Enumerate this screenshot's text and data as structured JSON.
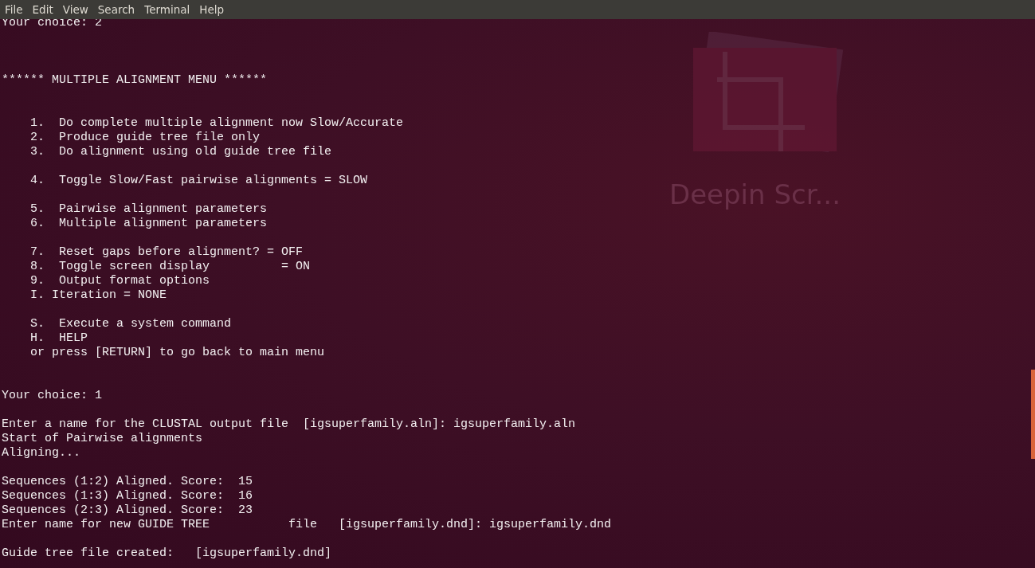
{
  "menu_bar": [
    "File",
    "Edit",
    "View",
    "Search",
    "Terminal",
    "Help"
  ],
  "background_app": {
    "label": "Deepin Scr..."
  },
  "terminal_lines": [
    {
      "kind": "text",
      "text": "Your choice: 2"
    },
    {
      "kind": "blank"
    },
    {
      "kind": "blank"
    },
    {
      "kind": "blank"
    },
    {
      "kind": "text",
      "text": "****** MULTIPLE ALIGNMENT MENU ******"
    },
    {
      "kind": "blank"
    },
    {
      "kind": "blank"
    },
    {
      "kind": "text",
      "text": "    1.  Do complete multiple alignment now Slow/Accurate"
    },
    {
      "kind": "text",
      "text": "    2.  Produce guide tree file only"
    },
    {
      "kind": "text",
      "text": "    3.  Do alignment using old guide tree file"
    },
    {
      "kind": "blank"
    },
    {
      "kind": "text",
      "text": "    4.  Toggle Slow/Fast pairwise alignments = SLOW"
    },
    {
      "kind": "blank"
    },
    {
      "kind": "text",
      "text": "    5.  Pairwise alignment parameters"
    },
    {
      "kind": "text",
      "text": "    6.  Multiple alignment parameters"
    },
    {
      "kind": "blank"
    },
    {
      "kind": "text",
      "text": "    7.  Reset gaps before alignment? = OFF"
    },
    {
      "kind": "text",
      "text": "    8.  Toggle screen display          = ON"
    },
    {
      "kind": "text",
      "text": "    9.  Output format options"
    },
    {
      "kind": "text",
      "text": "    I. Iteration = NONE"
    },
    {
      "kind": "blank"
    },
    {
      "kind": "text",
      "text": "    S.  Execute a system command"
    },
    {
      "kind": "text",
      "text": "    H.  HELP"
    },
    {
      "kind": "text",
      "text": "    or press [RETURN] to go back to main menu"
    },
    {
      "kind": "blank"
    },
    {
      "kind": "blank"
    },
    {
      "kind": "text",
      "text": "Your choice: 1"
    },
    {
      "kind": "blank"
    },
    {
      "kind": "text",
      "text": "Enter a name for the CLUSTAL output file  [igsuperfamily.aln]: igsuperfamily.aln"
    },
    {
      "kind": "text",
      "text": "Start of Pairwise alignments"
    },
    {
      "kind": "text",
      "text": "Aligning..."
    },
    {
      "kind": "blank"
    },
    {
      "kind": "text",
      "text": "Sequences (1:2) Aligned. Score:  15"
    },
    {
      "kind": "text",
      "text": "Sequences (1:3) Aligned. Score:  16"
    },
    {
      "kind": "text",
      "text": "Sequences (2:3) Aligned. Score:  23"
    },
    {
      "kind": "text",
      "text": "Enter name for new GUIDE TREE           file   [igsuperfamily.dnd]: igsuperfamily.dnd"
    },
    {
      "kind": "blank"
    },
    {
      "kind": "text",
      "text": "Guide tree file created:   [igsuperfamily.dnd]"
    }
  ]
}
